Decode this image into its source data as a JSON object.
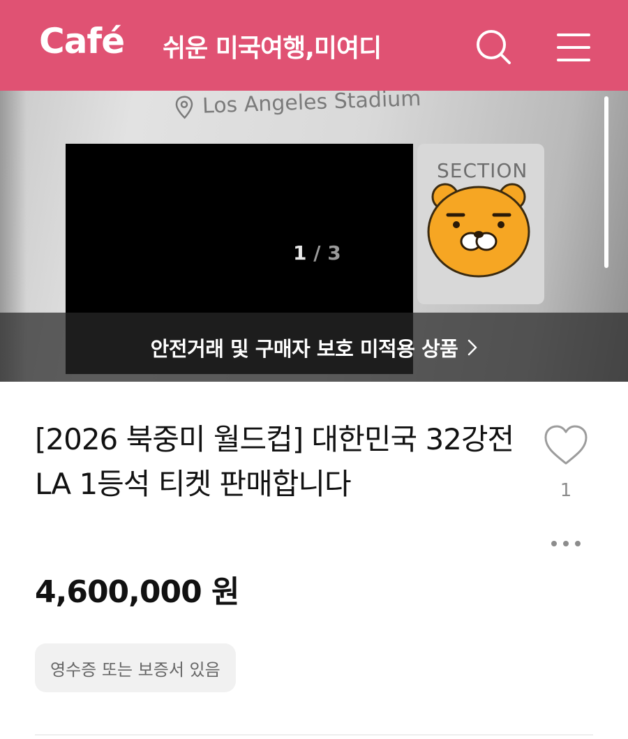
{
  "header": {
    "logo": "Café",
    "cafe_name": "쉬운 미국여행,미여디",
    "search_icon": "search-icon",
    "menu_icon": "hamburger-menu-icon",
    "bg_color": "#e05273"
  },
  "photo": {
    "location_text": "Los Angeles Stadium",
    "section_text": "SECTION",
    "counter": {
      "current": "1",
      "separator": " / ",
      "total": "3"
    },
    "sticker": "ryan-character-sticker",
    "notice": "안전거래 및 구매자 보호 미적용 상품"
  },
  "post": {
    "title": "[2026 북중미 월드컵] 대한민국 32강전 LA 1등석 티켓 판매합니다",
    "price": "4,600,000 원",
    "like_count": "1",
    "tag": "영수증 또는 보증서 있음"
  }
}
